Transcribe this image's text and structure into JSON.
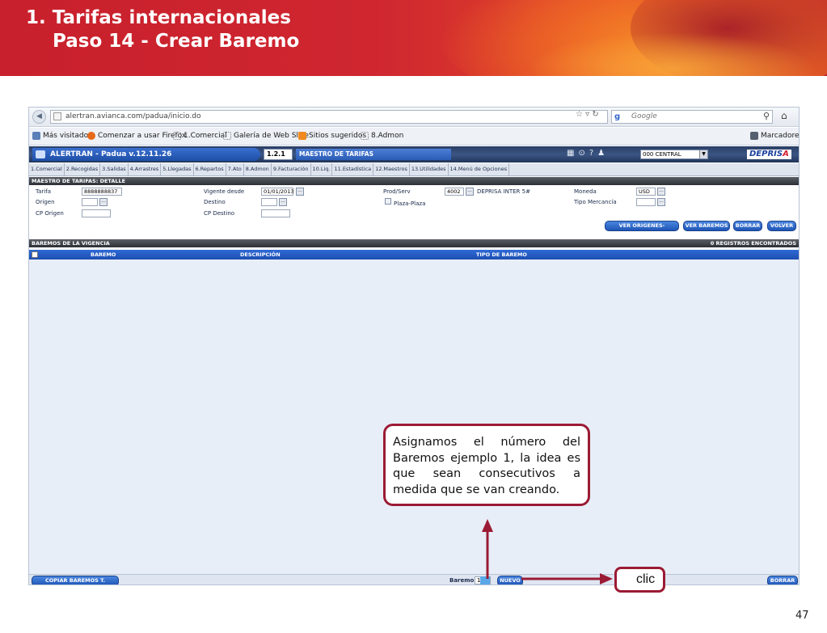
{
  "slide": {
    "title_line1": "1. Tarifas internacionales",
    "title_line2": "Paso 14 - Crear Baremo",
    "page_number": "47"
  },
  "browser": {
    "url": "alertran.avianca.com/padua/inicio.do",
    "search_placeholder": "Google",
    "bookmarks": [
      "Más visitados",
      "Comenzar a usar Firefox",
      "1.Comercial",
      "Galería de Web Slice",
      "Sitios sugeridos",
      "8.Admon"
    ],
    "bookmarks_right": "Marcadores"
  },
  "app": {
    "name": "ALERTRAN - Padua  v.12.11.26",
    "module_code": "1.2.1",
    "module_name": "MAESTRO DE TARIFAS",
    "office": "000 CENTRAL",
    "brand_a": "DEPRIS",
    "brand_b": "A",
    "menu": [
      "1.Comercial",
      "2.Recogidas",
      "3.Salidas",
      "4.Arrastres",
      "5.Llegadas",
      "6.Repartos",
      "7.Ato",
      "8.Admon",
      "9.Facturación",
      "10.Liq.",
      "11.Estadística",
      "12.Maestros",
      "13.Utilidades",
      "14.Menú de Opciones"
    ]
  },
  "detail": {
    "header": "MAESTRO DE TARIFAS: DETALLE",
    "tarifa_label": "Tarifa",
    "tarifa_value": "8888888837",
    "origen_label": "Origen",
    "cp_origen_label": "CP Origen",
    "vigente_label": "Vigente desde",
    "vigente_value": "01/01/2013",
    "destino_label": "Destino",
    "cp_destino_label": "CP Destino",
    "prod_label": "Prod/Serv",
    "prod_code": "4002",
    "prod_name": "DEPRISA INTER 5#",
    "plaza_label": "Plaza-Plaza",
    "moneda_label": "Moneda",
    "moneda_value": "USD",
    "tipo_merc_label": "Tipo Mercancía",
    "btn_origenes": "VER ORIGENES-DESTINOS",
    "btn_baremos": "VER BAREMOS",
    "btn_borrar": "BORRAR",
    "btn_volver": "VOLVER"
  },
  "table": {
    "section": "BAREMOS DE LA VIGENCIA",
    "count": "0 REGISTROS ENCONTRADOS",
    "columns": [
      "BAREMO",
      "DESCRIPCIÓN",
      "TIPO DE BAREMO"
    ]
  },
  "bottom": {
    "btn_copiar": "COPIAR BAREMOS T. GENERAL",
    "baremo_label": "Baremo",
    "baremo_value": "1",
    "btn_nuevo": "NUEVO",
    "btn_borrar": "BORRAR"
  },
  "callouts": {
    "note": "Asignamos el número del Baremos ejemplo 1, la idea es que sean consecutivos a medida que se van creando.",
    "click": "clic"
  },
  "colors": {
    "banner_red": "#c8202c",
    "callout_border": "#9b1b34",
    "app_blue": "#1f56b6"
  }
}
